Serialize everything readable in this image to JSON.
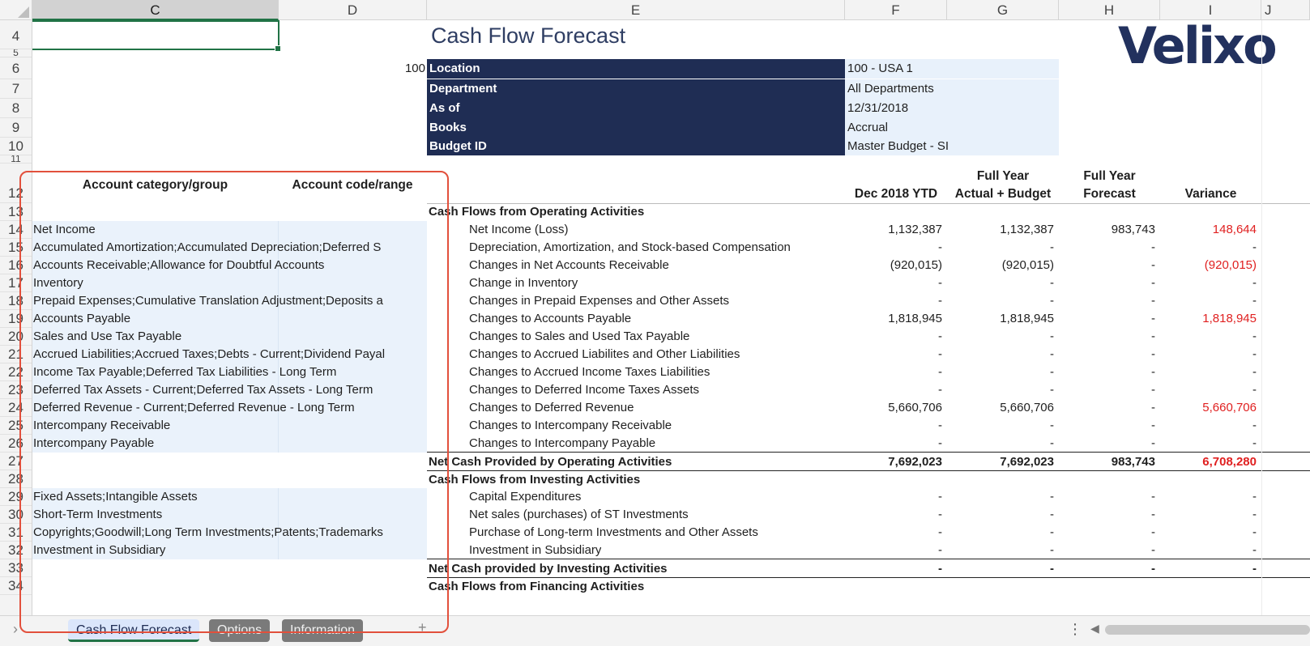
{
  "column_headers": [
    "C",
    "D",
    "E",
    "F",
    "G",
    "H",
    "I",
    "J"
  ],
  "row_numbers": [
    "4",
    "5",
    "6",
    "7",
    "8",
    "9",
    "10",
    "11",
    "12",
    "13",
    "14",
    "15",
    "16",
    "17",
    "18",
    "19",
    "20",
    "21",
    "22",
    "23",
    "24",
    "25",
    "26",
    "27",
    "28",
    "29",
    "30",
    "31",
    "32",
    "33",
    "34"
  ],
  "report": {
    "title": "Cash Flow Forecast",
    "logo_text": "Velixo",
    "location_code": "100",
    "params": [
      {
        "label": "Location",
        "value": "100 - USA 1"
      },
      {
        "label": "Department",
        "value": "All Departments"
      },
      {
        "label": "As of",
        "value": "12/31/2018"
      },
      {
        "label": "Books",
        "value": "Accrual"
      },
      {
        "label": "Budget ID",
        "value": "Master Budget - SI"
      }
    ],
    "left_headers": {
      "category": "Account category/group",
      "code": "Account code/range"
    },
    "col_headers": {
      "f": "Dec 2018 YTD",
      "g_line1": "Full Year",
      "g_line2": "Actual + Budget",
      "h_line1": "Full Year",
      "h_line2": "Forecast",
      "i": "Variance"
    }
  },
  "rows": {
    "r13": {
      "e": "Cash Flows from Operating Activities"
    },
    "r14": {
      "c": "Net Income",
      "e": "Net Income (Loss)",
      "f": "1,132,387",
      "g": "1,132,387",
      "h": "983,743",
      "i": "148,644"
    },
    "r15": {
      "c": "Accumulated Amortization;Accumulated Depreciation;Deferred S",
      "e": "Depreciation, Amortization, and Stock-based Compensation",
      "f": "-",
      "g": "-",
      "h": "-",
      "i": "-"
    },
    "r16": {
      "c": "Accounts Receivable;Allowance for Doubtful Accounts",
      "e": "Changes in Net Accounts Receivable",
      "f": "(920,015)",
      "g": "(920,015)",
      "h": "-",
      "i": "(920,015)"
    },
    "r17": {
      "c": "Inventory",
      "e": "Change in Inventory",
      "f": "-",
      "g": "-",
      "h": "-",
      "i": "-"
    },
    "r18": {
      "c": "Prepaid Expenses;Cumulative Translation Adjustment;Deposits a",
      "e": "Changes in Prepaid Expenses and Other Assets",
      "f": "-",
      "g": "-",
      "h": "-",
      "i": "-"
    },
    "r19": {
      "c": "Accounts Payable",
      "e": "Changes to Accounts Payable",
      "f": "1,818,945",
      "g": "1,818,945",
      "h": "-",
      "i": "1,818,945"
    },
    "r20": {
      "c": "Sales and Use Tax Payable",
      "e": "Changes to Sales and Used Tax Payable",
      "f": "-",
      "g": "-",
      "h": "-",
      "i": "-"
    },
    "r21": {
      "c": "Accrued Liabilities;Accrued Taxes;Debts - Current;Dividend Payal",
      "e": "Changes to Accrued Liabilites and Other Liabilities",
      "f": "-",
      "g": "-",
      "h": "-",
      "i": "-"
    },
    "r22": {
      "c": "Income Tax Payable;Deferred Tax Liabilities - Long Term",
      "e": "Changes to Accrued Income Taxes Liabilities",
      "f": "-",
      "g": "-",
      "h": "-",
      "i": "-"
    },
    "r23": {
      "c": "Deferred Tax Assets - Current;Deferred Tax Assets - Long Term",
      "e": "Changes to Deferred Income Taxes Assets",
      "f": "-",
      "g": "-",
      "h": "-",
      "i": "-"
    },
    "r24": {
      "c": "Deferred Revenue - Current;Deferred Revenue - Long Term",
      "e": "Changes to Deferred Revenue",
      "f": "5,660,706",
      "g": "5,660,706",
      "h": "-",
      "i": "5,660,706"
    },
    "r25": {
      "c": "Intercompany Receivable",
      "e": "Changes to Intercompany Receivable",
      "f": "-",
      "g": "-",
      "h": "-",
      "i": "-"
    },
    "r26": {
      "c": "Intercompany Payable",
      "e": "Changes to Intercompany Payable",
      "f": "-",
      "g": "-",
      "h": "-",
      "i": "-"
    },
    "r27": {
      "e": "Net Cash Provided by Operating Activities",
      "f": "7,692,023",
      "g": "7,692,023",
      "h": "983,743",
      "i": "6,708,280"
    },
    "r28": {
      "e": "Cash Flows from Investing Activities"
    },
    "r29": {
      "c": "Fixed Assets;Intangible Assets",
      "e": "Capital Expenditures",
      "f": "-",
      "g": "-",
      "h": "-",
      "i": "-"
    },
    "r30": {
      "c": "Short-Term Investments",
      "e": "Net sales (purchases) of ST Investments",
      "f": "-",
      "g": "-",
      "h": "-",
      "i": "-"
    },
    "r31": {
      "c": "Copyrights;Goodwill;Long Term Investments;Patents;Trademarks",
      "e": "Purchase of Long-term Investments and Other Assets",
      "f": "-",
      "g": "-",
      "h": "-",
      "i": "-"
    },
    "r32": {
      "c": "Investment in Subsidiary",
      "e": "Investment in Subsidiary",
      "f": "-",
      "g": "-",
      "h": "-",
      "i": "-"
    },
    "r33": {
      "e": "Net Cash provided by Investing Activities",
      "f": "-",
      "g": "-",
      "h": "-",
      "i": "-"
    },
    "r34": {
      "e": "Cash Flows from Financing Activities"
    }
  },
  "sheet_tabs": [
    "Cash Flow Forecast",
    "Options",
    "Information"
  ],
  "colors": {
    "navy": "#1f2d54",
    "accent_green": "#217346",
    "negative_red": "#e02020",
    "highlight": "#e2503c"
  }
}
